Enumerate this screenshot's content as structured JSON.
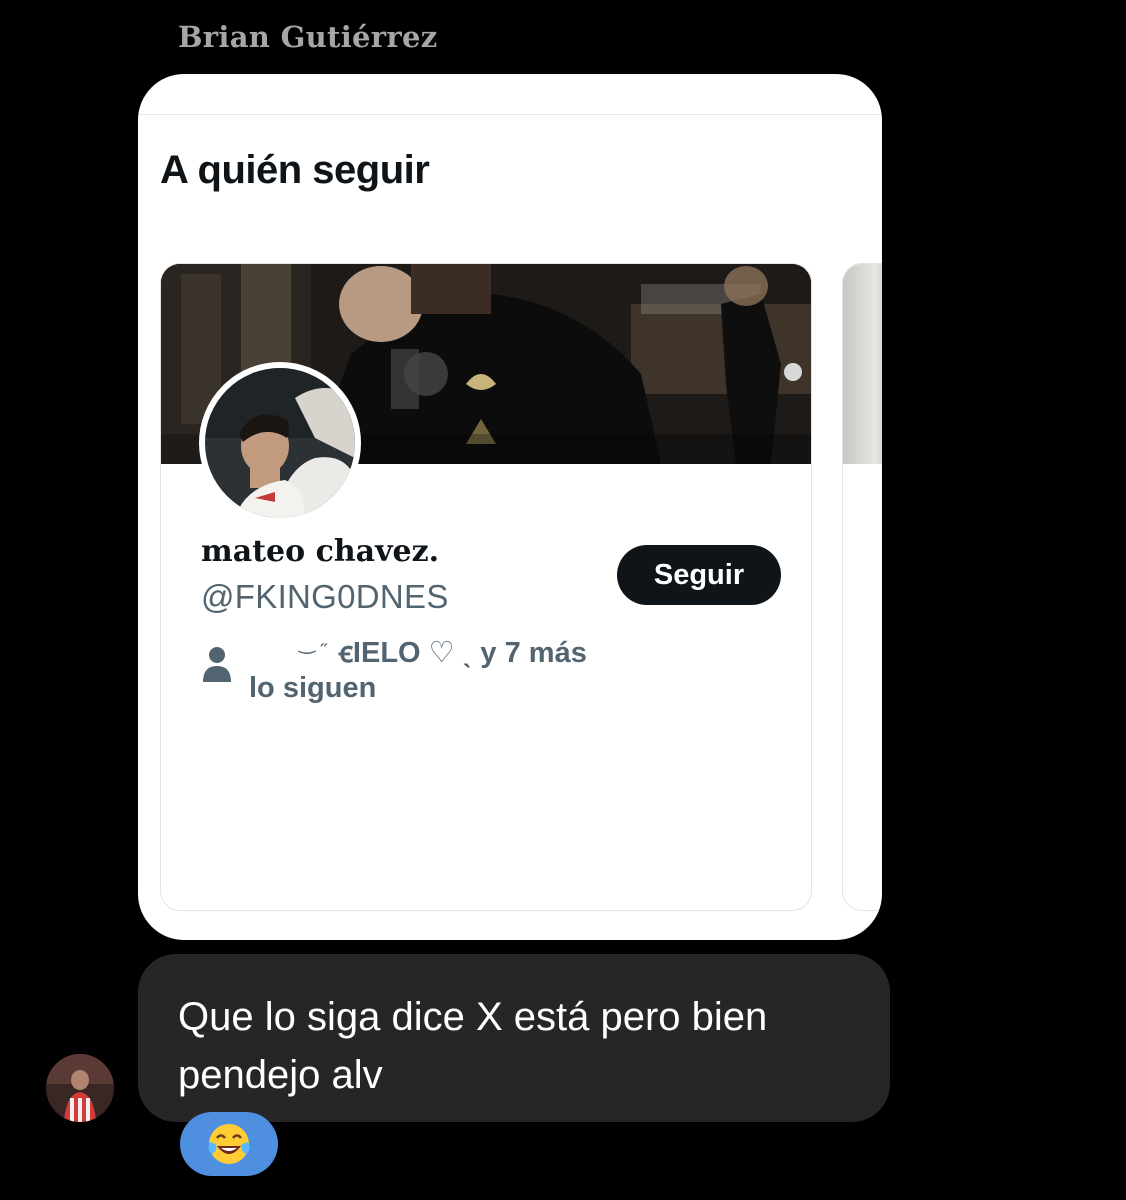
{
  "message": {
    "sender_name": "Brian Gutiérrez",
    "reply_text": "Que lo siga dice X está pero bien pendejo alv",
    "reaction_icon": "laughing-tears-icon"
  },
  "shared_post": {
    "section_title": "A quién seguir",
    "suggestion": {
      "display_name": "mateo chavez.",
      "handle": "@FKING0DNES",
      "follow_label": "Seguir",
      "followers_icon": "person-icon",
      "followers_names": "ꞓIELO ♡ ˎ y 7 más",
      "followers_label": "lo siguen"
    }
  },
  "colors": {
    "background": "#000000",
    "bubble": "#262626",
    "reaction": "#4e8fe0",
    "follow_button": "#0f1419",
    "secondary_text": "#536471"
  }
}
